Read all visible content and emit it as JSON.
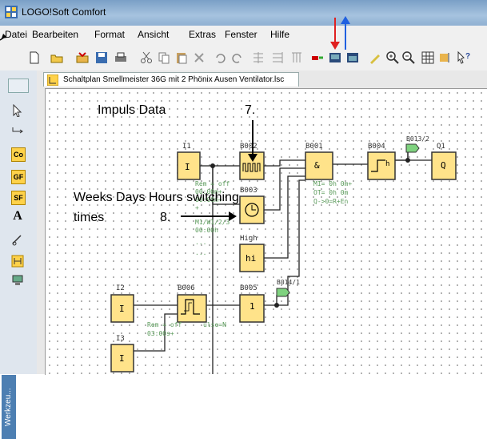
{
  "window": {
    "title": "LOGO!Soft Comfort"
  },
  "menu": [
    {
      "label": "Datei"
    },
    {
      "label": "Bearbeiten"
    },
    {
      "label": "Format"
    },
    {
      "label": "Ansicht"
    },
    {
      "label": "Extras"
    },
    {
      "label": "Fenster"
    },
    {
      "label": "Hilfe"
    }
  ],
  "document": {
    "tab_title": "Schaltplan Smellmeister 36G  mit 2 Phönix Ausen Ventilator.lsc"
  },
  "sidebar": {
    "tools": [
      {
        "icon": "select-arrow-icon"
      },
      {
        "icon": "connect-icon"
      },
      {
        "label": "Co"
      },
      {
        "label": "GF"
      },
      {
        "label": "SF"
      },
      {
        "label": "A"
      },
      {
        "icon": "cut-connection-icon"
      },
      {
        "icon": "ladder-icon"
      },
      {
        "icon": "network-icon"
      }
    ],
    "panel_label": "Werkzeu..."
  },
  "blocks": {
    "I1": {
      "name": "I1",
      "symbol": "I"
    },
    "B002": {
      "name": "B002",
      "symbol": "Impuls",
      "params": [
        "Rem = off",
        "00:00m+",
        "00:00m+",
        "+",
        "M1/W1/2/3",
        "00:00h",
        "...",
        "..."
      ]
    },
    "B001": {
      "name": "B001",
      "symbol": "&",
      "params": [
        "MI= 0h 0m+",
        "OT= 0h 0m",
        "Q->0=R+En"
      ]
    },
    "B004": {
      "name": "B004",
      "symbol": "h"
    },
    "B013": {
      "name": "B013/2"
    },
    "Q1": {
      "name": "Q1",
      "symbol": "Q"
    },
    "clock": {
      "name": "B003",
      "symbol": "clock"
    },
    "High": {
      "name": "High",
      "symbol": "hi"
    },
    "I2": {
      "name": "I2",
      "symbol": "I"
    },
    "B006": {
      "name": "B006",
      "params": [
        "Rem = off",
        "03:00s+",
        "ulse=N"
      ]
    },
    "B005": {
      "name": "B005",
      "symbol": "1"
    },
    "B014": {
      "name": "B014/1"
    },
    "I3": {
      "name": "I3",
      "symbol": "I"
    }
  },
  "annotations": {
    "impuls": "Impuls Data",
    "seven": "7.",
    "weeks": "Weeks Days Hours switching",
    "times": "times",
    "eight": "8."
  },
  "colors": {
    "block_fill": "#ffe38a",
    "block_stroke": "#333333",
    "arrow_red": "#e02020",
    "arrow_blue": "#2060e0",
    "flag_fill": "#7fd27f"
  }
}
